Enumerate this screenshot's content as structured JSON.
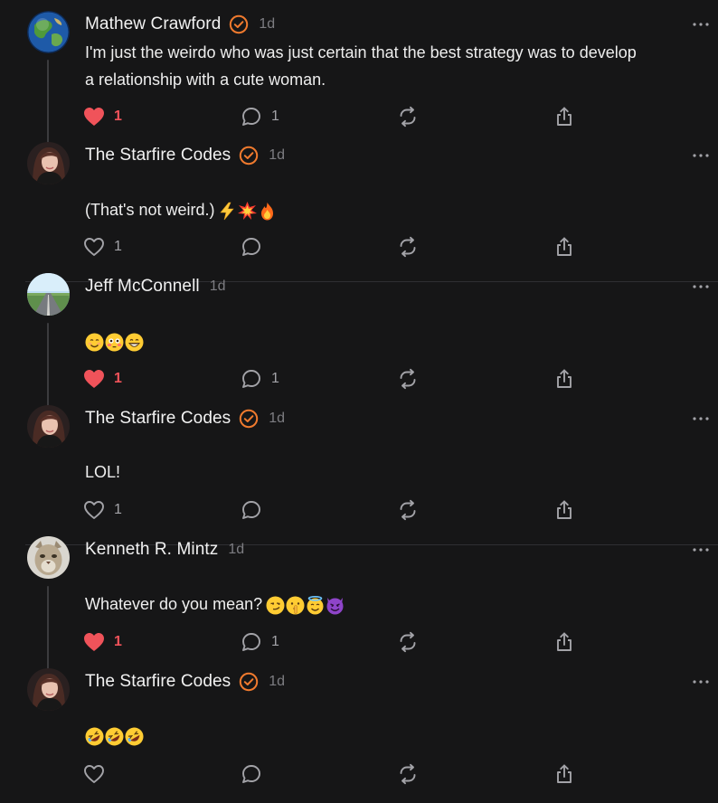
{
  "posts": [
    {
      "author": "Mathew Crawford",
      "verified": true,
      "time": "1d",
      "text_lines": [
        "I'm just the weirdo who was just certain that the best strategy was to develop",
        "a relationship with a cute woman."
      ],
      "text_suffix": "",
      "emojis": [],
      "liked": true,
      "like_count": "1",
      "comment_count": "1",
      "avatar": "earth-globe"
    },
    {
      "author": "The Starfire Codes",
      "verified": true,
      "time": "1d",
      "text_lines": [
        "(That's not weird.)"
      ],
      "emojis": [
        "high-voltage",
        "collision",
        "fire"
      ],
      "liked": false,
      "like_count": "1",
      "comment_count": "",
      "avatar": "woman-portrait"
    },
    {
      "author": "Jeff McConnell",
      "verified": false,
      "time": "1d",
      "text_lines": [],
      "emojis": [
        "smiling-face",
        "flushed-face",
        "grinning-face"
      ],
      "liked": true,
      "like_count": "1",
      "comment_count": "1",
      "avatar": "road-landscape"
    },
    {
      "author": "The Starfire Codes",
      "verified": true,
      "time": "1d",
      "text_lines": [
        "LOL!"
      ],
      "emojis": [],
      "liked": false,
      "like_count": "1",
      "comment_count": "",
      "avatar": "woman-portrait"
    },
    {
      "author": "Kenneth R. Mintz",
      "verified": false,
      "time": "1d",
      "text_lines": [
        "Whatever do you mean?"
      ],
      "emojis": [
        "smirking-face",
        "shushing-face",
        "halo-face",
        "devil-face"
      ],
      "liked": true,
      "like_count": "1",
      "comment_count": "1",
      "avatar": "cougar"
    },
    {
      "author": "The Starfire Codes",
      "verified": true,
      "time": "1d",
      "text_lines": [],
      "emojis": [
        "rofl-face",
        "rofl-face",
        "rofl-face"
      ],
      "liked": false,
      "like_count": "",
      "comment_count": "",
      "avatar": "woman-portrait"
    }
  ],
  "colors": {
    "background": "#161617",
    "like_active": "#f0535a",
    "verified_badge": "#f07a2e",
    "muted_text": "#7d7d82",
    "divider": "#2f2f33"
  },
  "icons": {
    "like": "heart-icon",
    "comment": "speech-bubble-icon",
    "restack": "restack-arrows-icon",
    "share": "share-upload-icon",
    "more": "more-options-icon",
    "verified": "verified-badge-icon"
  }
}
